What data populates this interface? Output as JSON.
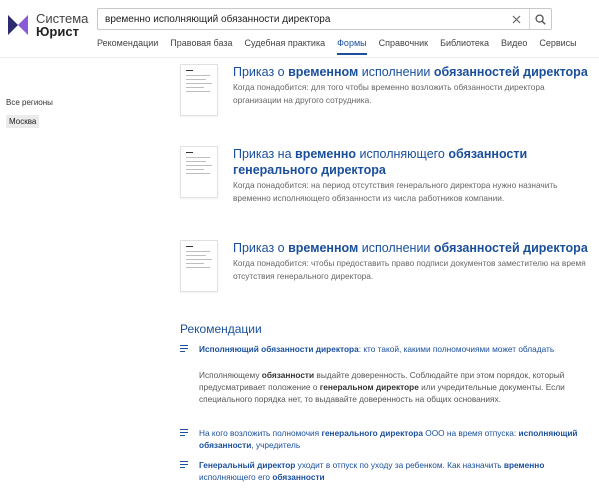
{
  "logo": {
    "line1": "Система",
    "line2": "Юрист"
  },
  "search": {
    "value": "временно исполняющий обязанности директора",
    "clear_icon": "close-icon",
    "search_icon": "search-icon"
  },
  "nav": [
    "Рекомендации",
    "Правовая база",
    "Судебная практика",
    "Формы",
    "Справочник",
    "Библиотека",
    "Видео",
    "Сервисы"
  ],
  "nav_active": "Формы",
  "regions": {
    "all": "Все регионы",
    "selected": "Москва"
  },
  "documents": [
    {
      "title": [
        {
          "t": "Приказ о ",
          "b": false
        },
        {
          "t": "временном",
          "b": true
        },
        {
          "t": " исполнении ",
          "b": false
        },
        {
          "t": "обязанностей директора",
          "b": true
        }
      ],
      "desc": "Когда понадобится: для того чтобы временно возложить обязанности директора организации на другого сотрудника."
    },
    {
      "title": [
        {
          "t": "Приказ на ",
          "b": false
        },
        {
          "t": "временно",
          "b": true
        },
        {
          "t": " исполняющего ",
          "b": false
        },
        {
          "t": "обязанности генерального директора",
          "b": true
        }
      ],
      "desc": "Когда понадобится: на период отсутствия генерального директора нужно назначить временно исполняющего обязанности из числа работников компании."
    },
    {
      "title": [
        {
          "t": "Приказ о ",
          "b": false
        },
        {
          "t": "временном",
          "b": true
        },
        {
          "t": " исполнении ",
          "b": false
        },
        {
          "t": "обязанностей директора",
          "b": true
        }
      ],
      "desc": "Когда понадобится: чтобы предоставить право подписи документов заместителю на время отсутствия генерального директора."
    }
  ],
  "recommendations": {
    "title": "Рекомендации",
    "items": [
      {
        "link": [
          {
            "t": "Исполняющий обязанности директора",
            "b": true
          },
          {
            "t": ": кто такой, какими полномочиями может обладать",
            "b": false
          }
        ],
        "text": [
          {
            "t": "Исполняющему ",
            "b": false
          },
          {
            "t": "обязанности",
            "b": true
          },
          {
            "t": " выдайте доверенность. Соблюдайте при этом порядок, который предусматривает положение о ",
            "b": false
          },
          {
            "t": "генеральном директоре",
            "b": true
          },
          {
            "t": " или учредительные документы. Если специального порядка нет, то выдавайте доверенность на общих основаниях.",
            "b": false
          }
        ]
      },
      {
        "link": [
          {
            "t": "На кого возложить полномочия ",
            "b": false
          },
          {
            "t": "генерального директора",
            "b": true
          },
          {
            "t": " ООО на время отпуска: ",
            "b": false
          },
          {
            "t": "исполняющий обязанности",
            "b": true
          },
          {
            "t": ", учредитель",
            "b": false
          }
        ]
      },
      {
        "link": [
          {
            "t": "Генеральный директор",
            "b": true
          },
          {
            "t": " уходит в отпуск по уходу за ребенком. Как назначить ",
            "b": false
          },
          {
            "t": "временно",
            "b": true
          },
          {
            "t": " исполняющего его ",
            "b": false
          },
          {
            "t": "обязанности",
            "b": true
          }
        ]
      }
    ]
  },
  "colors": {
    "accent": "#1a4f9c",
    "logo_dark": "#2b2b6e",
    "logo_purple": "#8a5bd6"
  }
}
